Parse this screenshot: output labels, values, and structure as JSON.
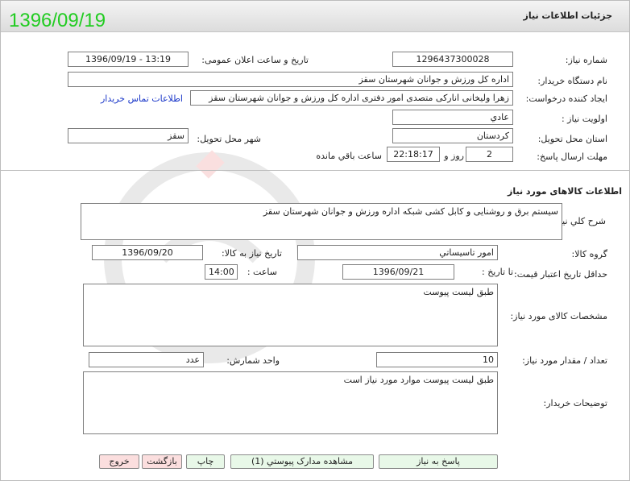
{
  "header": {
    "title": "جزئیات اطلاعات نیاز",
    "date_stamp": "1396/09/19"
  },
  "need_info": {
    "need_number_label": "شماره نیاز:",
    "need_number": "1296437300028",
    "announce_datetime_label": "تاریخ و ساعت اعلان عمومی:",
    "announce_datetime": "1396/09/19 - 13:19",
    "buyer_org_label": "نام دستگاه خریدار:",
    "buyer_org": "اداره کل ورزش و جوانان شهرستان سقز",
    "requester_label": "ایجاد کننده درخواست:",
    "requester": "زهرا ولیخانی اناركی متصدی امور دفتری اداره کل ورزش و جوانان شهرستان سقز",
    "contact_link": "اطلاعات تماس خریدار",
    "priority_label": "اولویت نیاز :",
    "priority": "عادي",
    "province_label": "استان محل تحویل:",
    "province": "کردستان",
    "city_label": "شهر محل تحویل:",
    "city": "سقز",
    "deadline_label": "مهلت ارسال پاسخ:",
    "deadline_days": "2",
    "days_and": "روز و",
    "deadline_time": "22:18:17",
    "remaining_label": "ساعت باقي مانده"
  },
  "goods": {
    "section_title": "اطلاعات کالاهای مورد نیاز",
    "description_label": "شرح کلي نیاز:",
    "description": "سیستم برق و روشنایی و کابل کشی شبکه اداره ورزش و جوانان شهرستان سقز",
    "group_label": "گروه کالا:",
    "group": "امور تاسیساتي",
    "need_date_label": "تاریخ نیاز به کالا:",
    "need_date": "1396/09/20",
    "validity_label": "حداقل تاریخ اعتبار قیمت:",
    "until_date_label": "تا تاریخ :",
    "until_date": "1396/09/21",
    "time_label": "ساعت :",
    "time": "14:00",
    "specs_label": "مشخصات کالای مورد نیاز:",
    "specs": "طبق لیست پیوست",
    "quantity_label": "تعداد / مقدار مورد نیاز:",
    "quantity": "10",
    "unit_label": "واحد شمارش:",
    "unit": "عدد",
    "buyer_notes_label": "توضیحات خریدار:",
    "buyer_notes": "طبق لیست پیوست موارد مورد نیاز است"
  },
  "buttons": {
    "reply": "پاسخ به نیاز",
    "view_docs": "مشاهده مدارک پیوستي (1)",
    "print": "چاپ",
    "back": "بازگشت",
    "exit": "خروج"
  },
  "colors": {
    "date_stamp": "#22cc22",
    "link": "#1a37c9",
    "green_button": "#e8f8e8",
    "red_button": "#fbdede"
  },
  "icons": {
    "watermark": "ariatender-logo-watermark"
  }
}
